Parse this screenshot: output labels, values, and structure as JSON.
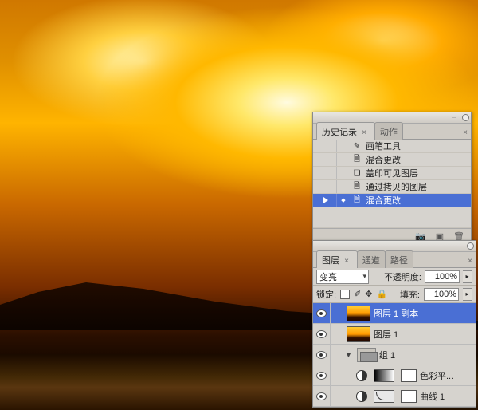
{
  "history_panel": {
    "tabs": {
      "active": "历史记录",
      "inactive": "动作"
    },
    "items": [
      {
        "icon": "brush",
        "label": "画笔工具"
      },
      {
        "icon": "doc",
        "label": "混合更改"
      },
      {
        "icon": "stack",
        "label": "盖印可见图层"
      },
      {
        "icon": "doc",
        "label": "通过拷贝的图层"
      },
      {
        "icon": "doc",
        "label": "混合更改",
        "selected": true,
        "playing": true
      }
    ]
  },
  "layers_panel": {
    "tabs": {
      "t0": "图层",
      "t1": "通道",
      "t2": "路径"
    },
    "blend_mode": "变亮",
    "opacity_label": "不透明度:",
    "opacity_value": "100%",
    "lock_label": "锁定:",
    "fill_label": "填充:",
    "fill_value": "100%",
    "layers": {
      "l0": "图层 1 副本",
      "l1": "图层 1",
      "g0": "组 1",
      "a0": "色彩平...",
      "a1": "曲线 1"
    }
  }
}
